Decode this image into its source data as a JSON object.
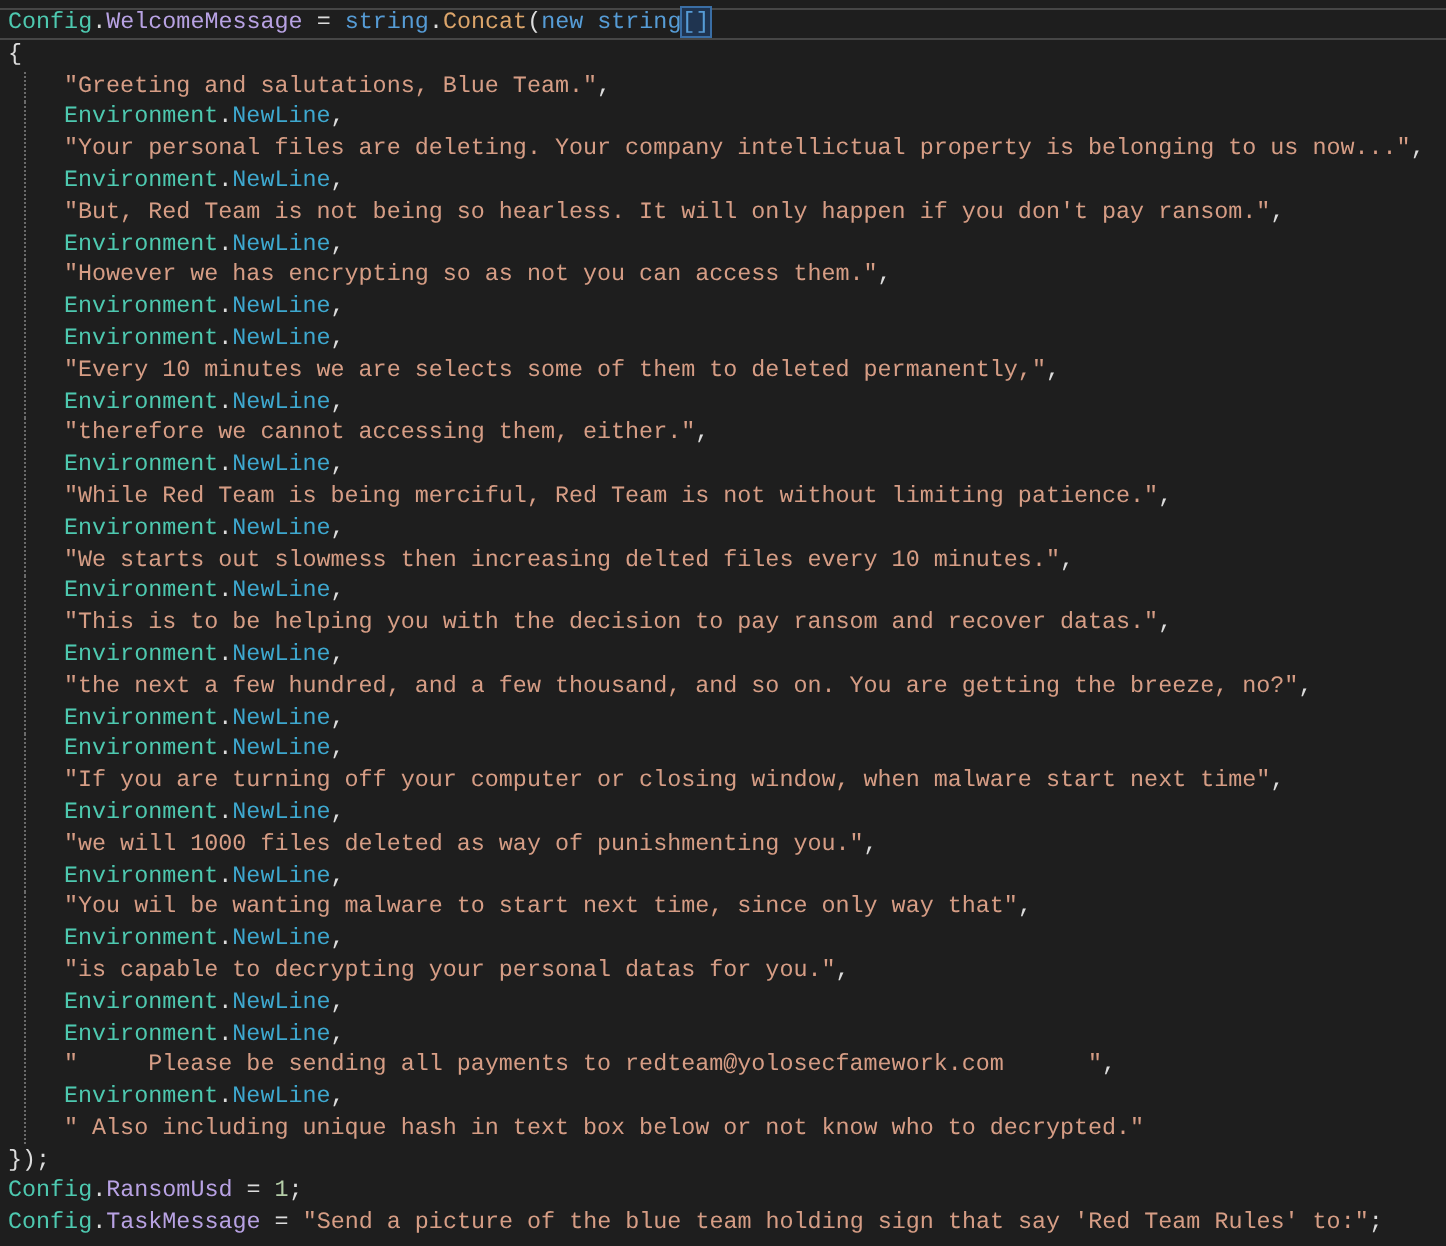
{
  "editor": {
    "lines": [
      {
        "current": true,
        "tokens": [
          {
            "kind": "class",
            "text": "Config"
          },
          {
            "kind": "punct",
            "text": "."
          },
          {
            "kind": "property",
            "text": "WelcomeMessage"
          },
          {
            "kind": "punct",
            "text": " = "
          },
          {
            "kind": "keyword",
            "text": "string"
          },
          {
            "kind": "punct",
            "text": "."
          },
          {
            "kind": "method",
            "text": "Concat"
          },
          {
            "kind": "punct",
            "text": "("
          },
          {
            "kind": "keyword",
            "text": "new string"
          },
          {
            "kind": "bracket",
            "text": "[]"
          }
        ]
      },
      {
        "current": false,
        "tokens": [
          {
            "kind": "punct",
            "text": "{"
          }
        ],
        "children": [
          {
            "current": false,
            "tokens": [
              {
                "kind": "string",
                "text": "\"Greeting and salutations, Blue Team.\""
              },
              {
                "kind": "punct",
                "text": ","
              }
            ]
          },
          {
            "current": false,
            "tokens": [
              {
                "kind": "class",
                "text": "Environment"
              },
              {
                "kind": "punct",
                "text": "."
              },
              {
                "kind": "field",
                "text": "NewLine"
              },
              {
                "kind": "punct",
                "text": ","
              }
            ]
          },
          {
            "current": false,
            "tokens": [
              {
                "kind": "string",
                "text": "\"Your personal files are deleting. Your company intellictual property is belonging to us now...\""
              },
              {
                "kind": "punct",
                "text": ","
              }
            ]
          },
          {
            "current": false,
            "tokens": [
              {
                "kind": "class",
                "text": "Environment"
              },
              {
                "kind": "punct",
                "text": "."
              },
              {
                "kind": "field",
                "text": "NewLine"
              },
              {
                "kind": "punct",
                "text": ","
              }
            ]
          },
          {
            "current": false,
            "tokens": [
              {
                "kind": "string",
                "text": "\"But, Red Team is not being so hearless. It will only happen if you don't pay ransom.\""
              },
              {
                "kind": "punct",
                "text": ","
              }
            ]
          },
          {
            "current": false,
            "tokens": [
              {
                "kind": "class",
                "text": "Environment"
              },
              {
                "kind": "punct",
                "text": "."
              },
              {
                "kind": "field",
                "text": "NewLine"
              },
              {
                "kind": "punct",
                "text": ","
              }
            ]
          },
          {
            "current": false,
            "tokens": [
              {
                "kind": "string",
                "text": "\"However we has encrypting so as not you can access them.\""
              },
              {
                "kind": "punct",
                "text": ","
              }
            ]
          },
          {
            "current": false,
            "tokens": [
              {
                "kind": "class",
                "text": "Environment"
              },
              {
                "kind": "punct",
                "text": "."
              },
              {
                "kind": "field",
                "text": "NewLine"
              },
              {
                "kind": "punct",
                "text": ","
              }
            ]
          },
          {
            "current": false,
            "tokens": [
              {
                "kind": "class",
                "text": "Environment"
              },
              {
                "kind": "punct",
                "text": "."
              },
              {
                "kind": "field",
                "text": "NewLine"
              },
              {
                "kind": "punct",
                "text": ","
              }
            ]
          },
          {
            "current": false,
            "tokens": [
              {
                "kind": "string",
                "text": "\"Every 10 minutes we are selects some of them to deleted permanently,\""
              },
              {
                "kind": "punct",
                "text": ","
              }
            ]
          },
          {
            "current": false,
            "tokens": [
              {
                "kind": "class",
                "text": "Environment"
              },
              {
                "kind": "punct",
                "text": "."
              },
              {
                "kind": "field",
                "text": "NewLine"
              },
              {
                "kind": "punct",
                "text": ","
              }
            ]
          },
          {
            "current": false,
            "tokens": [
              {
                "kind": "string",
                "text": "\"therefore we cannot accessing them, either.\""
              },
              {
                "kind": "punct",
                "text": ","
              }
            ]
          },
          {
            "current": false,
            "tokens": [
              {
                "kind": "class",
                "text": "Environment"
              },
              {
                "kind": "punct",
                "text": "."
              },
              {
                "kind": "field",
                "text": "NewLine"
              },
              {
                "kind": "punct",
                "text": ","
              }
            ]
          },
          {
            "current": false,
            "tokens": [
              {
                "kind": "string",
                "text": "\"While Red Team is being merciful, Red Team is not without limiting patience.\""
              },
              {
                "kind": "punct",
                "text": ","
              }
            ]
          },
          {
            "current": false,
            "tokens": [
              {
                "kind": "class",
                "text": "Environment"
              },
              {
                "kind": "punct",
                "text": "."
              },
              {
                "kind": "field",
                "text": "NewLine"
              },
              {
                "kind": "punct",
                "text": ","
              }
            ]
          },
          {
            "current": false,
            "tokens": [
              {
                "kind": "string",
                "text": "\"We starts out slowmess then increasing delted files every 10 minutes.\""
              },
              {
                "kind": "punct",
                "text": ","
              }
            ]
          },
          {
            "current": false,
            "tokens": [
              {
                "kind": "class",
                "text": "Environment"
              },
              {
                "kind": "punct",
                "text": "."
              },
              {
                "kind": "field",
                "text": "NewLine"
              },
              {
                "kind": "punct",
                "text": ","
              }
            ]
          },
          {
            "current": false,
            "tokens": [
              {
                "kind": "string",
                "text": "\"This is to be helping you with the decision to pay ransom and recover datas.\""
              },
              {
                "kind": "punct",
                "text": ","
              }
            ]
          },
          {
            "current": false,
            "tokens": [
              {
                "kind": "class",
                "text": "Environment"
              },
              {
                "kind": "punct",
                "text": "."
              },
              {
                "kind": "field",
                "text": "NewLine"
              },
              {
                "kind": "punct",
                "text": ","
              }
            ]
          },
          {
            "current": false,
            "tokens": [
              {
                "kind": "string",
                "text": "\"the next a few hundred, and a few thousand, and so on. You are getting the breeze, no?\""
              },
              {
                "kind": "punct",
                "text": ","
              }
            ]
          },
          {
            "current": false,
            "tokens": [
              {
                "kind": "class",
                "text": "Environment"
              },
              {
                "kind": "punct",
                "text": "."
              },
              {
                "kind": "field",
                "text": "NewLine"
              },
              {
                "kind": "punct",
                "text": ","
              }
            ]
          },
          {
            "current": false,
            "tokens": [
              {
                "kind": "class",
                "text": "Environment"
              },
              {
                "kind": "punct",
                "text": "."
              },
              {
                "kind": "field",
                "text": "NewLine"
              },
              {
                "kind": "punct",
                "text": ","
              }
            ]
          },
          {
            "current": false,
            "tokens": [
              {
                "kind": "string",
                "text": "\"If you are turning off your computer or closing window, when malware start next time\""
              },
              {
                "kind": "punct",
                "text": ","
              }
            ]
          },
          {
            "current": false,
            "tokens": [
              {
                "kind": "class",
                "text": "Environment"
              },
              {
                "kind": "punct",
                "text": "."
              },
              {
                "kind": "field",
                "text": "NewLine"
              },
              {
                "kind": "punct",
                "text": ","
              }
            ]
          },
          {
            "current": false,
            "tokens": [
              {
                "kind": "string",
                "text": "\"we will 1000 files deleted as way of punishmenting you.\""
              },
              {
                "kind": "punct",
                "text": ","
              }
            ]
          },
          {
            "current": false,
            "tokens": [
              {
                "kind": "class",
                "text": "Environment"
              },
              {
                "kind": "punct",
                "text": "."
              },
              {
                "kind": "field",
                "text": "NewLine"
              },
              {
                "kind": "punct",
                "text": ","
              }
            ]
          },
          {
            "current": false,
            "tokens": [
              {
                "kind": "string",
                "text": "\"You wil be wanting malware to start next time, since only way that\""
              },
              {
                "kind": "punct",
                "text": ","
              }
            ]
          },
          {
            "current": false,
            "tokens": [
              {
                "kind": "class",
                "text": "Environment"
              },
              {
                "kind": "punct",
                "text": "."
              },
              {
                "kind": "field",
                "text": "NewLine"
              },
              {
                "kind": "punct",
                "text": ","
              }
            ]
          },
          {
            "current": false,
            "tokens": [
              {
                "kind": "string",
                "text": "\"is capable to decrypting your personal datas for you.\""
              },
              {
                "kind": "punct",
                "text": ","
              }
            ]
          },
          {
            "current": false,
            "tokens": [
              {
                "kind": "class",
                "text": "Environment"
              },
              {
                "kind": "punct",
                "text": "."
              },
              {
                "kind": "field",
                "text": "NewLine"
              },
              {
                "kind": "punct",
                "text": ","
              }
            ]
          },
          {
            "current": false,
            "tokens": [
              {
                "kind": "class",
                "text": "Environment"
              },
              {
                "kind": "punct",
                "text": "."
              },
              {
                "kind": "field",
                "text": "NewLine"
              },
              {
                "kind": "punct",
                "text": ","
              }
            ]
          },
          {
            "current": false,
            "tokens": [
              {
                "kind": "string",
                "text": "\"     Please be sending all payments to redteam@yolosecfamework.com      \""
              },
              {
                "kind": "punct",
                "text": ","
              }
            ]
          },
          {
            "current": false,
            "tokens": [
              {
                "kind": "class",
                "text": "Environment"
              },
              {
                "kind": "punct",
                "text": "."
              },
              {
                "kind": "field",
                "text": "NewLine"
              },
              {
                "kind": "punct",
                "text": ","
              }
            ]
          },
          {
            "current": false,
            "tokens": [
              {
                "kind": "string",
                "text": "\" Also including unique hash in text box below or not know who to decrypted.\""
              }
            ]
          }
        ]
      },
      {
        "current": false,
        "tokens": [
          {
            "kind": "punct",
            "text": "});"
          }
        ]
      },
      {
        "current": false,
        "tokens": [
          {
            "kind": "class",
            "text": "Config"
          },
          {
            "kind": "punct",
            "text": "."
          },
          {
            "kind": "property",
            "text": "RansomUsd"
          },
          {
            "kind": "punct",
            "text": " = "
          },
          {
            "kind": "number",
            "text": "1"
          },
          {
            "kind": "punct",
            "text": ";"
          }
        ]
      },
      {
        "current": false,
        "tokens": [
          {
            "kind": "class",
            "text": "Config"
          },
          {
            "kind": "punct",
            "text": "."
          },
          {
            "kind": "property",
            "text": "TaskMessage"
          },
          {
            "kind": "punct",
            "text": " = "
          },
          {
            "kind": "string",
            "text": "\"Send a picture of the blue team holding sign that say 'Red Team Rules' to:\""
          },
          {
            "kind": "punct",
            "text": ";"
          }
        ]
      }
    ]
  }
}
